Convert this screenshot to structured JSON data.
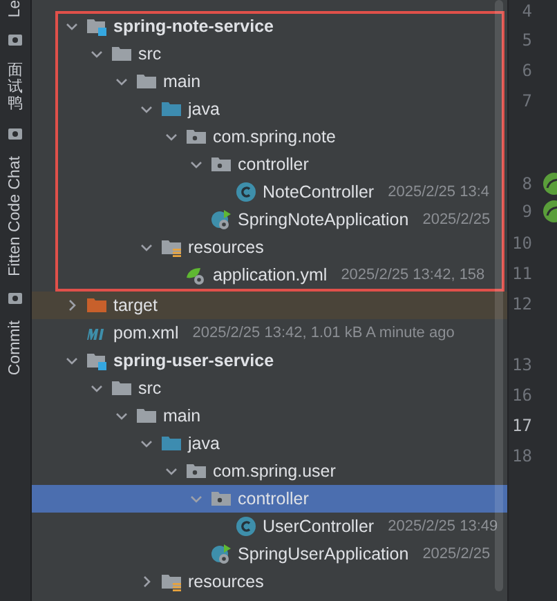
{
  "tool_strip": [
    {
      "kind": "text",
      "label": "Le"
    },
    {
      "kind": "icon"
    },
    {
      "kind": "vertical_cjk",
      "label": "面试鸭"
    },
    {
      "kind": "icon"
    },
    {
      "kind": "text",
      "label": "Fitten Code Chat"
    },
    {
      "kind": "icon"
    },
    {
      "kind": "text",
      "label": "Commit"
    }
  ],
  "tree": [
    {
      "name": "spring-note-service",
      "kind": "module",
      "expanded": true,
      "selected": false,
      "outlined": true,
      "children": [
        {
          "name": "src",
          "kind": "folder",
          "expanded": true,
          "selected": false,
          "children": [
            {
              "name": "main",
              "kind": "folder",
              "expanded": true,
              "selected": false,
              "children": [
                {
                  "name": "java",
                  "kind": "source",
                  "expanded": true,
                  "selected": false,
                  "children": [
                    {
                      "name": "com.spring.note",
                      "kind": "package",
                      "expanded": true,
                      "selected": false,
                      "children": [
                        {
                          "name": "controller",
                          "kind": "package",
                          "expanded": true,
                          "selected": false,
                          "children": [
                            {
                              "name": "NoteController",
                              "kind": "class",
                              "selected": false,
                              "meta": "2025/2/25 13:4"
                            }
                          ]
                        },
                        {
                          "name": "SpringNoteApplication",
                          "kind": "app",
                          "selected": false,
                          "meta": "2025/2/25"
                        }
                      ]
                    }
                  ]
                },
                {
                  "name": "resources",
                  "kind": "resources",
                  "expanded": true,
                  "selected": false,
                  "children": [
                    {
                      "name": "application.yml",
                      "kind": "yml",
                      "selected": false,
                      "meta": "2025/2/25 13:42, 158"
                    }
                  ]
                }
              ]
            }
          ]
        }
      ]
    },
    {
      "name": "target",
      "kind": "excluded",
      "expanded": false,
      "selected": false
    },
    {
      "name": "pom.xml",
      "kind": "maven",
      "selected": false,
      "meta": "2025/2/25 13:42, 1.01 kB A minute ago"
    },
    {
      "name": "spring-user-service",
      "kind": "module",
      "expanded": true,
      "selected": false,
      "outlined": false,
      "children": [
        {
          "name": "src",
          "kind": "folder",
          "expanded": true,
          "selected": false,
          "children": [
            {
              "name": "main",
              "kind": "folder",
              "expanded": true,
              "selected": false,
              "children": [
                {
                  "name": "java",
                  "kind": "source",
                  "expanded": true,
                  "selected": false,
                  "children": [
                    {
                      "name": "com.spring.user",
                      "kind": "package",
                      "expanded": true,
                      "selected": false,
                      "children": [
                        {
                          "name": "controller",
                          "kind": "package",
                          "expanded": true,
                          "selected": true,
                          "children": [
                            {
                              "name": "UserController",
                              "kind": "class",
                              "selected": false,
                              "meta": "2025/2/25 13:49"
                            }
                          ]
                        },
                        {
                          "name": "SpringUserApplication",
                          "kind": "app",
                          "selected": false,
                          "meta": "2025/2/25"
                        }
                      ]
                    }
                  ]
                },
                {
                  "name": "resources",
                  "kind": "resources",
                  "expanded": false,
                  "selected": false
                }
              ]
            }
          ]
        }
      ]
    }
  ],
  "gutter": [
    {
      "number": "4",
      "current": false
    },
    {
      "number": "5",
      "current": false
    },
    {
      "number": "6",
      "current": false
    },
    {
      "number": "7",
      "current": false
    },
    {
      "number": "8",
      "current": false,
      "kind": "bean"
    },
    {
      "number": "9",
      "current": false,
      "kind": "bean"
    },
    {
      "number": "10",
      "current": false
    },
    {
      "number": "11",
      "current": false
    },
    {
      "number": "12",
      "current": false
    },
    {
      "number": "13",
      "current": false
    },
    {
      "number": "16",
      "current": false
    },
    {
      "number": "17",
      "current": true
    },
    {
      "number": "18",
      "current": false
    }
  ]
}
